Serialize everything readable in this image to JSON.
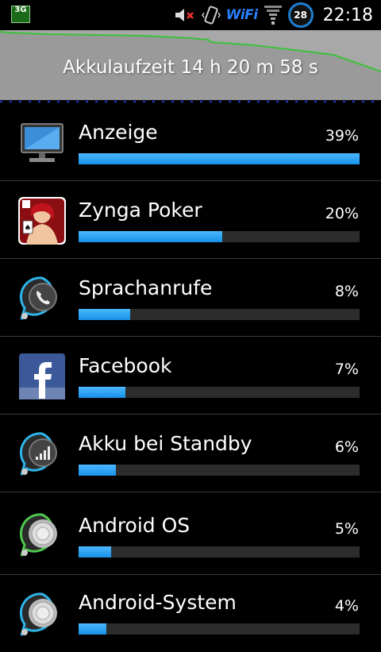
{
  "status_bar": {
    "network_badge": "3G",
    "wifi_label": "WiFi",
    "battery_level": "28",
    "time": "22:18"
  },
  "battery_header": {
    "title": "Akkulaufzeit 14 h 20 m 58 s"
  },
  "colors": {
    "accent_bar": "#29a0ee",
    "graph_line": "#3cc23c",
    "graph_background": "#a8a8a8"
  },
  "usage_list": [
    {
      "name": "Anzeige",
      "percent_label": "39%",
      "fill": 1.0,
      "icon": "monitor-icon"
    },
    {
      "name": "Zynga Poker",
      "percent_label": "20%",
      "fill": 0.51,
      "icon": "zynga-poker-icon"
    },
    {
      "name": "Sprachanrufe",
      "percent_label": "8%",
      "fill": 0.185,
      "icon": "phone-call-icon"
    },
    {
      "name": "Facebook",
      "percent_label": "7%",
      "fill": 0.168,
      "icon": "facebook-icon"
    },
    {
      "name": "Akku bei Standby",
      "percent_label": "6%",
      "fill": 0.133,
      "icon": "signal-bars-icon"
    },
    {
      "name": "Android OS",
      "percent_label": "5%",
      "fill": 0.115,
      "icon": "android-os-icon"
    },
    {
      "name": "Android-System",
      "percent_label": "4%",
      "fill": 0.1,
      "icon": "android-system-icon"
    }
  ]
}
